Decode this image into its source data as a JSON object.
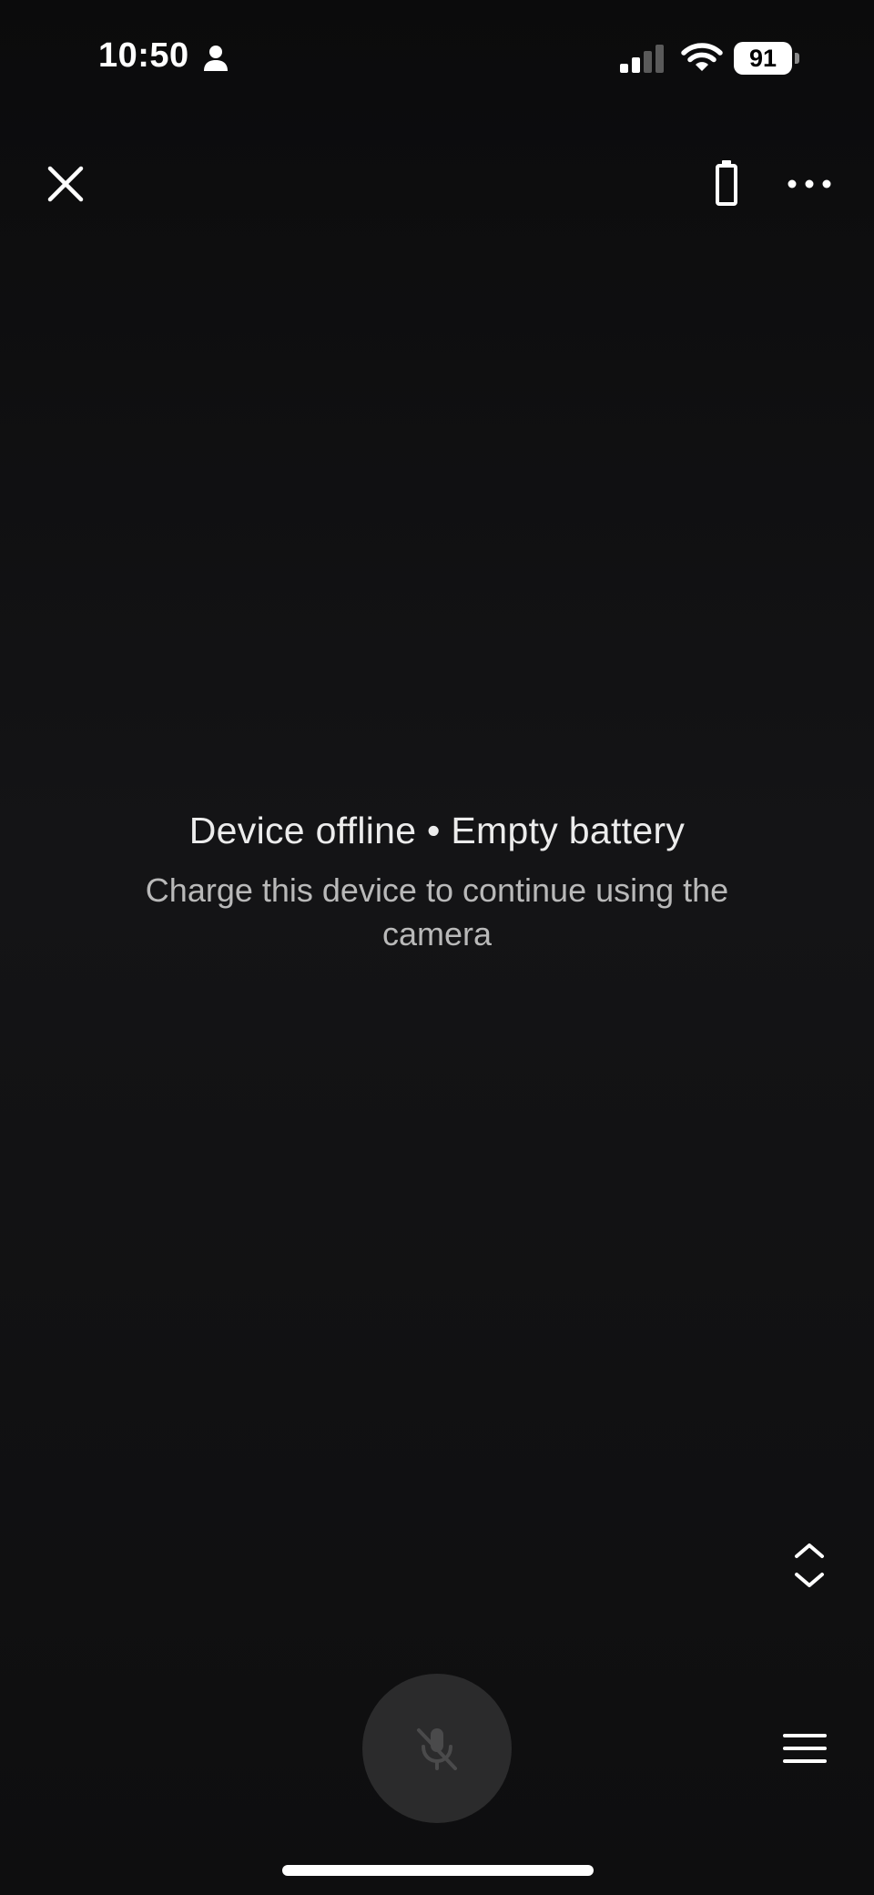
{
  "status_bar": {
    "time": "10:50",
    "person_icon": "person-icon",
    "signal_icon": "cellular-signal-icon",
    "signal_level": "2 of 4 bars",
    "wifi_icon": "wifi-icon",
    "battery_percent": "91"
  },
  "top_bar": {
    "close_icon": "close-icon",
    "battery_icon": "battery-empty-icon",
    "more_icon": "more-horizontal-icon"
  },
  "message": {
    "title": "Device offline • Empty battery",
    "body": "Charge this device to continue using the camera"
  },
  "bottom_bar": {
    "expand_icon": "expand-collapse-icon",
    "mic_icon": "microphone-off-icon",
    "menu_icon": "menu-icon"
  },
  "colors": {
    "background": "#0c0c0d",
    "title_text": "#ececec",
    "body_text": "#b9b9b9",
    "mic_button_bg": "#2b2b2c",
    "icon_color": "#ffffff"
  }
}
